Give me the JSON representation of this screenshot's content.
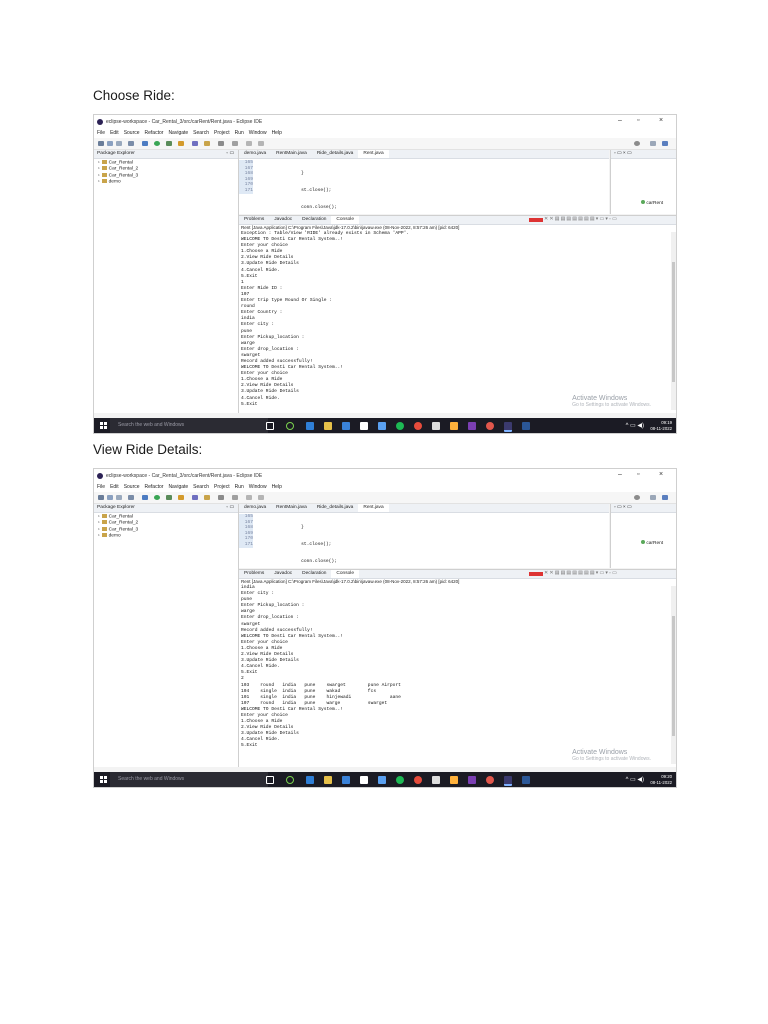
{
  "sections": [
    {
      "heading": "Choose Ride:",
      "screenshot": {
        "window_title": "eclipse-workspace - Car_Rental_3/src/carRent/Rent.java - Eclipse IDE",
        "menu": [
          "File",
          "Edit",
          "Source",
          "Refactor",
          "Navigate",
          "Search",
          "Project",
          "Run",
          "Window",
          "Help"
        ],
        "package_explorer_title": "Package Explorer",
        "projects": [
          "Car_Rental",
          "Car_Rental_2",
          "Car_Rental_3",
          "demo"
        ],
        "editor_tabs": [
          "demo.java",
          "RentMain.java",
          "Ride_details.java",
          "Rent.java"
        ],
        "code_line_numbers": [
          "165",
          "167",
          "168",
          "169",
          "170",
          "171"
        ],
        "code_lines": [
          "                }",
          "                st.close();",
          "                conn.close();",
          "            } catch (Exception e) {",
          "                System.out.println(\"Exception : \" + e.getMessage());",
          "            }"
        ],
        "outline_label": "carRent",
        "console_tabs": [
          "Problems",
          "Javadoc",
          "Declaration",
          "Console"
        ],
        "console_status": "Rent [Java Application] C:\\Program Files\\Java\\jdk-17.0.2\\bin\\javaw.exe (08-Nov-2022, 8:57:26 am) [pid: 6420]",
        "console_output": "Exception : Table/View 'RIDE' already exists in Schema 'APP'.\nWELCOME TO Desti Car Rental System..!\nEnter your choice\n1.Choose a Ride\n2.View Ride Details\n3.Update Ride Details\n4.Cancel Ride.\n5.Exit\n1\nEnter Ride ID :\n107\nEnter trip type Round Or Single :\nround\nEnter Country :\nindia\nEnter city :\npune\nEnter Pickup_location :\nwarge\nEnter drop_location :\nswarget\nRecord added successfully!\nWELCOME TO Desti Car Rental System..!\nEnter your choice\n1.Choose a Ride\n2.View Ride Details\n3.Update Ride Details\n4.Cancel Ride.\n5.Exit",
        "watermark_title": "Activate Windows",
        "watermark_sub": "Go to Settings to activate Windows.",
        "taskbar_search": "Search the web and Windows",
        "clock_time": "09:19",
        "clock_date": "08-11-2022"
      }
    },
    {
      "heading": "View Ride Details:",
      "screenshot": {
        "window_title": "eclipse-workspace - Car_Rental_3/src/carRent/Rent.java - Eclipse IDE",
        "menu": [
          "File",
          "Edit",
          "Source",
          "Refactor",
          "Navigate",
          "Search",
          "Project",
          "Run",
          "Window",
          "Help"
        ],
        "package_explorer_title": "Package Explorer",
        "projects": [
          "Car_Rental",
          "Car_Rental_2",
          "Car_Rental_3",
          "demo"
        ],
        "editor_tabs": [
          "demo.java",
          "RentMain.java",
          "Ride_details.java",
          "Rent.java"
        ],
        "code_line_numbers": [
          "165",
          "167",
          "168",
          "169",
          "170",
          "171"
        ],
        "code_lines": [
          "                }",
          "                st.close();",
          "                conn.close();",
          "            } catch (Exception e) {",
          "                System.out.println(\"Exception : \" + e.getMessage());",
          "            }"
        ],
        "outline_label": "carRent",
        "console_tabs": [
          "Problems",
          "Javadoc",
          "Declaration",
          "Console"
        ],
        "console_status": "Rent [Java Application] C:\\Program Files\\Java\\jdk-17.0.2\\bin\\javaw.exe (08-Nov-2022, 8:57:26 am) [pid: 6420]",
        "console_output": "india\nEnter city :\npune\nEnter Pickup_location :\nwarge\nEnter drop_location :\nswarget\nRecord added successfully!\nWELCOME TO Desti Car Rental System..!\nEnter your choice\n1.Choose a Ride\n2.View Ride Details\n3.Update Ride Details\n4.Cancel Ride.\n5.Exit\n2\n103    round   india   pune    swarget        pune Airport\n104    single  india   pune    wakad          fcs\n101    single  india   pune    hinjewadi              aane\n107    round   india   pune    warge          swarget\nWELCOME TO Desti Car Rental System..!\nEnter your choice\n1.Choose a Ride\n2.View Ride Details\n3.Update Ride Details\n4.Cancel Ride.\n5.Exit",
        "watermark_title": "Activate Windows",
        "watermark_sub": "Go to Settings to activate Windows.",
        "taskbar_search": "Search the web and Windows",
        "clock_time": "09:20",
        "clock_date": "08-11-2022"
      }
    }
  ]
}
